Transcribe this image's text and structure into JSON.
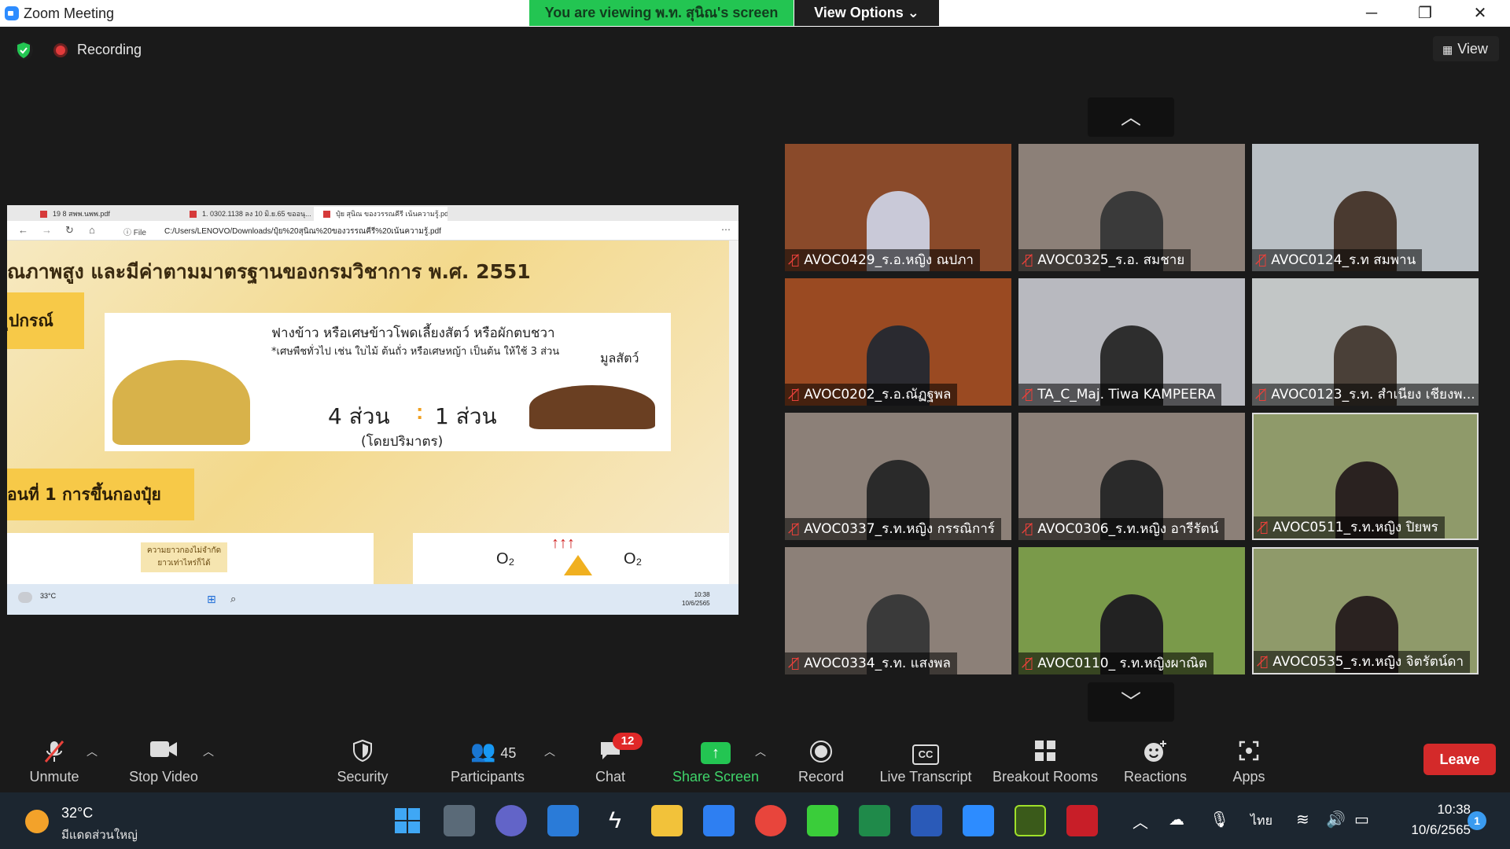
{
  "window": {
    "title": "Zoom Meeting",
    "viewing_banner": "You are viewing พ.ท. สุนิณ's screen",
    "view_options": "View Options ⌄",
    "minimize": "─",
    "maximize": "❐",
    "close": "✕"
  },
  "recording": {
    "label": "Recording"
  },
  "view_button": {
    "label": "View"
  },
  "shared_screen": {
    "tabs": [
      "19 8 สพพ.นพพ.pdf",
      "1. 0302.1138 ลง 10 มิ.ย.65 ขออนุ...",
      "ปุ๋ย สุนิณ ของวรรณคีรี เน้นความรู้.pdf"
    ],
    "file_label": "ⓘ File",
    "url": "C:/Users/LENOVO/Downloads/ปุ๋ย%20สุนิณ%20ของวรรณคีรี%20เน้นความรู้.pdf",
    "heading": "ณภาพสูง และมีค่าตามมาตรฐานของกรมวิชาการ พ.ศ. 2551",
    "label_left": "ุปกรณ์",
    "straw_title": "ฟางข้าว หรือเศษข้าวโพดเลี้ยงสัตว์ หรือผักตบชวา",
    "straw_note": "*เศษพืชทั่วไป เช่น ใบไม้ ต้นถั่ว หรือเศษหญ้า เป็นต้น ให้ใช้ 3 ส่วน",
    "manure_label": "มูลสัตว์",
    "ratio_left": "4 ส่วน",
    "ratio_colon": ":",
    "ratio_right": "1 ส่วน",
    "ratio_unit": "(โดยปริมาตร)",
    "step_label": "อนที่ 1 การขึ้นกองปุ๋ย",
    "bottom_note": "ความยาวกองไม่จำกัด ยาวเท่าไหร่ก็ได้",
    "gas_left": "O₂",
    "gas_right": "O₂",
    "taskbar_temp": "33°C",
    "taskbar_time": "10:38",
    "taskbar_date": "10/6/2565"
  },
  "gallery": {
    "tiles": [
      {
        "name": "AVOC0429_ร.อ.หญิง ณปภา",
        "bg": "#8a4a2a",
        "person": "#c9c9d8"
      },
      {
        "name": "AVOC0325_ร.อ. สมชาย",
        "bg": "#8c8078",
        "person": "#3a3a3a"
      },
      {
        "name": "AVOC0124_ร.ท สมพาน",
        "bg": "#b9bfc4",
        "person": "#4a3a30"
      },
      {
        "name": "AVOC0202_ร.อ.ณัฏฐพล",
        "bg": "#9a4a22",
        "person": "#2a2a30"
      },
      {
        "name": "TA_C_Maj. Tiwa KAMPEERA",
        "bg": "#b8b9bf",
        "person": "#2e2e2e"
      },
      {
        "name": "AVOC0123_ร.ท. สำเนียง เชียงพ...",
        "bg": "#c2c6c6",
        "person": "#4a4038"
      },
      {
        "name": "AVOC0337_ร.ท.หญิง กรรณิการ์",
        "bg": "#8c8078",
        "person": "#2a2a2a"
      },
      {
        "name": "AVOC0306_ร.ท.หญิง อารีรัตน์",
        "bg": "#8c8078",
        "person": "#2a2a2a"
      },
      {
        "name": "AVOC0511_ร.ท.หญิง ปิยพร",
        "bg": "#8f9a6a",
        "person": "#2a2220"
      },
      {
        "name": "AVOC0334_ร.ท. แสงพล",
        "bg": "#8c8078",
        "person": "#3a3a3a"
      },
      {
        "name": "AVOC0110_ ร.ท.หญิงผาณิต",
        "bg": "#7a9a4a",
        "person": "#222222"
      },
      {
        "name": "AVOC0535_ร.ท.หญิง จิตรัตน์ดา",
        "bg": "#8f9a6a",
        "person": "#2a2220"
      }
    ],
    "up_arrow": "︿",
    "down_arrow": "﹀"
  },
  "controls": {
    "unmute": "Unmute",
    "stop_video": "Stop Video",
    "security": "Security",
    "participants": "Participants",
    "participants_count": "45",
    "chat": "Chat",
    "chat_badge": "12",
    "share_screen": "Share Screen",
    "record": "Record",
    "live_transcript": "Live Transcript",
    "breakout_rooms": "Breakout Rooms",
    "reactions": "Reactions",
    "apps": "Apps",
    "leave": "Leave",
    "cc": "CC"
  },
  "taskbar": {
    "temp": "32°C",
    "weather": "มีแดดส่วนใหญ่",
    "lang": "ไทย",
    "time": "10:38",
    "date": "10/6/2565",
    "notifications": "1"
  }
}
